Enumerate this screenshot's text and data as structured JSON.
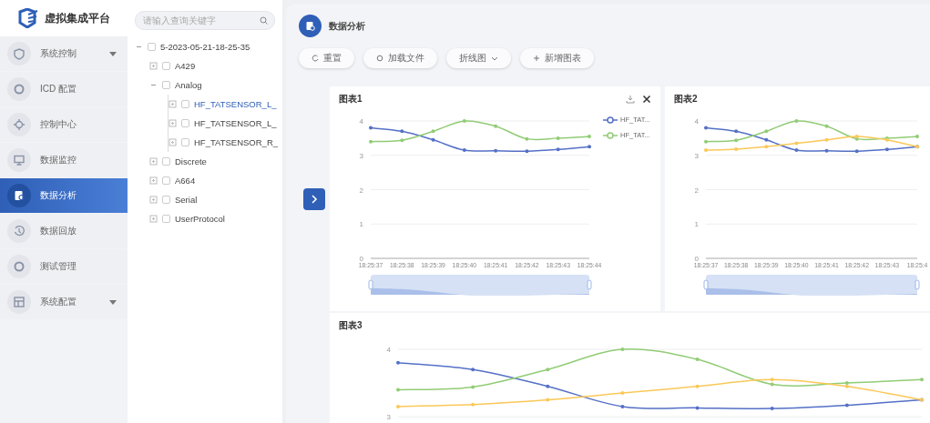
{
  "sidebar": {
    "logo": "虚拟集成平台",
    "items": [
      {
        "label": "系统控制",
        "selected": false,
        "expandable": true
      },
      {
        "label": "ICD 配置",
        "selected": false,
        "expandable": false
      },
      {
        "label": "控制中心",
        "selected": false,
        "expandable": false
      },
      {
        "label": "数据监控",
        "selected": false,
        "expandable": false
      },
      {
        "label": "数据分析",
        "selected": true,
        "expandable": false
      },
      {
        "label": "数据回放",
        "selected": false,
        "expandable": false
      },
      {
        "label": "测试管理",
        "selected": false,
        "expandable": false
      },
      {
        "label": "系统配置",
        "selected": false,
        "expandable": true
      }
    ]
  },
  "tree": {
    "search": {
      "placeholder": "请输入查询关键字"
    },
    "nodes": [
      {
        "label": "5-2023-05-21-18-25-35",
        "expanded": true,
        "checked": false,
        "selected": false,
        "children": [
          {
            "label": "A429",
            "expanded": false,
            "checked": false,
            "selected": false
          },
          {
            "label": "Analog",
            "expanded": true,
            "checked": false,
            "selected": false,
            "children": [
              {
                "label": "HF_TATSENSOR_L_",
                "expanded": false,
                "checked": false,
                "selected": true
              },
              {
                "label": "HF_TATSENSOR_L_",
                "expanded": false,
                "checked": false,
                "selected": false
              },
              {
                "label": "HF_TATSENSOR_R_",
                "expanded": false,
                "checked": false,
                "selected": false
              }
            ]
          },
          {
            "label": "Discrete",
            "expanded": false,
            "checked": false,
            "selected": false
          },
          {
            "label": "A664",
            "expanded": false,
            "checked": false,
            "selected": false
          },
          {
            "label": "Serial",
            "expanded": false,
            "checked": false,
            "selected": false
          },
          {
            "label": "UserProtocol",
            "expanded": false,
            "checked": false,
            "selected": false
          }
        ]
      }
    ]
  },
  "page": {
    "title": "数据分析"
  },
  "toolbar": [
    {
      "label": "重置",
      "dropdown": false
    },
    {
      "label": "加载文件",
      "dropdown": false
    },
    {
      "label": "折线图",
      "dropdown": true
    },
    {
      "label": "新增图表",
      "dropdown": false
    }
  ],
  "charts": [
    {
      "title": "图表1",
      "actions": true,
      "chart_data": {
        "type": "line",
        "grid": true,
        "categories": [
          "18:25:37",
          "18:25:38",
          "18:25:39",
          "18:25:40",
          "18:25:41",
          "18:25:42",
          "18:25:43",
          "18:25:44"
        ],
        "ylim": [
          0,
          4
        ],
        "yticks": [
          0,
          1,
          2,
          3,
          4
        ],
        "series": [
          {
            "name": "HF_TAT...",
            "color": "#5470c6",
            "values": [
              3.8,
              3.7,
              3.45,
              3.15,
              3.13,
              3.12,
              3.17,
              3.25
            ]
          },
          {
            "name": "HF_TAT...",
            "color": "#91cc75",
            "values": [
              3.4,
              3.44,
              3.7,
              4.0,
              3.85,
              3.48,
              3.5,
              3.55
            ]
          }
        ]
      }
    },
    {
      "title": "图表2",
      "actions": false,
      "chart_data": {
        "type": "line",
        "grid": true,
        "categories": [
          "18:25:37",
          "18:25:38",
          "18:25:39",
          "18:25:40",
          "18:25:41",
          "18:25:42",
          "18:25:43",
          "18:25:4"
        ],
        "ylim": [
          0,
          4
        ],
        "yticks": [
          0,
          1,
          2,
          3,
          4
        ],
        "series": [
          {
            "color": "#5470c6",
            "values": [
              3.8,
              3.7,
              3.45,
              3.15,
              3.13,
              3.12,
              3.17,
              3.25
            ]
          },
          {
            "color": "#91cc75",
            "values": [
              3.4,
              3.44,
              3.7,
              4.0,
              3.85,
              3.48,
              3.5,
              3.55
            ]
          },
          {
            "color": "#fac858",
            "values": [
              3.15,
              3.18,
              3.25,
              3.35,
              3.45,
              3.55,
              3.45,
              3.25
            ]
          }
        ]
      }
    },
    {
      "title": "图表3",
      "actions": false,
      "y_labels": [
        "4",
        "3"
      ]
    }
  ]
}
